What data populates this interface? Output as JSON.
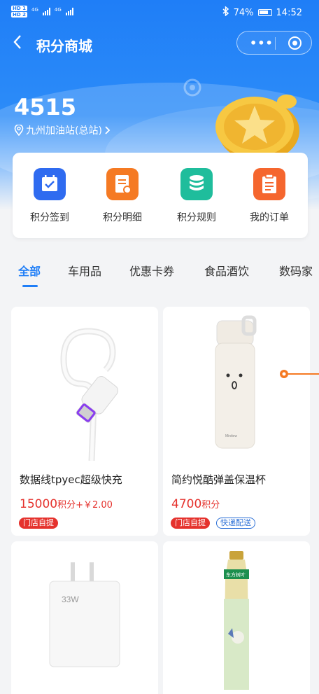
{
  "status_bar": {
    "sim1": "HD 1",
    "sim2": "HD 2",
    "network1": "4G",
    "network2": "4G",
    "bluetooth_icon": "bluetooth-icon",
    "battery": "74%",
    "time": "14:52"
  },
  "nav": {
    "back_icon": "chevron-left-icon",
    "title": "积分商城",
    "more_icon": "more-dots-icon",
    "close_icon": "target-circle-icon"
  },
  "account": {
    "points": "4515",
    "station": "九州加油站(总站)",
    "location_icon": "location-pin-icon"
  },
  "menu": [
    {
      "label": "积分签到",
      "icon": "calendar-check-icon",
      "color": "#2f6bf0"
    },
    {
      "label": "积分明细",
      "icon": "document-detail-icon",
      "color": "#f57a23"
    },
    {
      "label": "积分规则",
      "icon": "database-stack-icon",
      "color": "#1fbd9c"
    },
    {
      "label": "我的订单",
      "icon": "clipboard-list-icon",
      "color": "#f5662e"
    }
  ],
  "tabs": [
    "全部",
    "车用品",
    "优惠卡券",
    "食品酒饮",
    "数码家"
  ],
  "active_tab": "全部",
  "products": [
    {
      "name": "数据线tpyec超级快充",
      "price_points": "15000",
      "price_unit": "积分",
      "price_extra": "+￥2.00",
      "tags": [
        "门店自提"
      ]
    },
    {
      "name": "简约悦酷弹盖保温杯",
      "price_points": "4700",
      "price_unit": "积分",
      "price_extra": "",
      "tags": [
        "门店自提",
        "快递配送"
      ]
    },
    {
      "name": "",
      "image_text": "33W"
    },
    {
      "name": "",
      "image_text": "东方树叶"
    }
  ],
  "colors": {
    "primary": "#1f7ef7",
    "price_red": "#e5322d",
    "tag_blue": "#2b6fd6"
  }
}
